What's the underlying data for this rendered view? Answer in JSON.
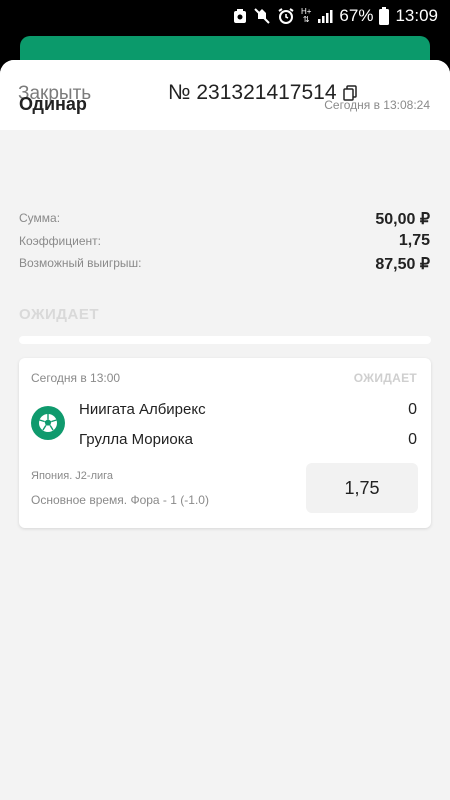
{
  "status_bar": {
    "battery": "67%",
    "time": "13:09",
    "network": "H+"
  },
  "header": {
    "close_label": "Закрыть",
    "ticket_number": "№ 231321417514"
  },
  "bet": {
    "type": "Одинар",
    "placed_at": "Сегодня в 13:08:24",
    "rows": [
      {
        "label": "Сумма:",
        "value": "50,00 ₽"
      },
      {
        "label": "Коэффициент:",
        "value": "1,75"
      },
      {
        "label": "Возможный выигрыш:",
        "value": "87,50 ₽"
      }
    ],
    "status": "ОЖИДАЕТ"
  },
  "event": {
    "time": "Сегодня в 13:00",
    "status": "ОЖИДАЕТ",
    "sport_icon": "soccer-ball-icon",
    "team1": {
      "name": "Ниигата Албирекс",
      "score": "0"
    },
    "team2": {
      "name": "Грулла Мориока",
      "score": "0"
    },
    "league": "Япония. J2-лига",
    "market": "Основное время. Фора - 1 (-1.0)",
    "odds": "1,75"
  },
  "colors": {
    "accent": "#0f9a6d",
    "background": "#f3f3f3"
  }
}
